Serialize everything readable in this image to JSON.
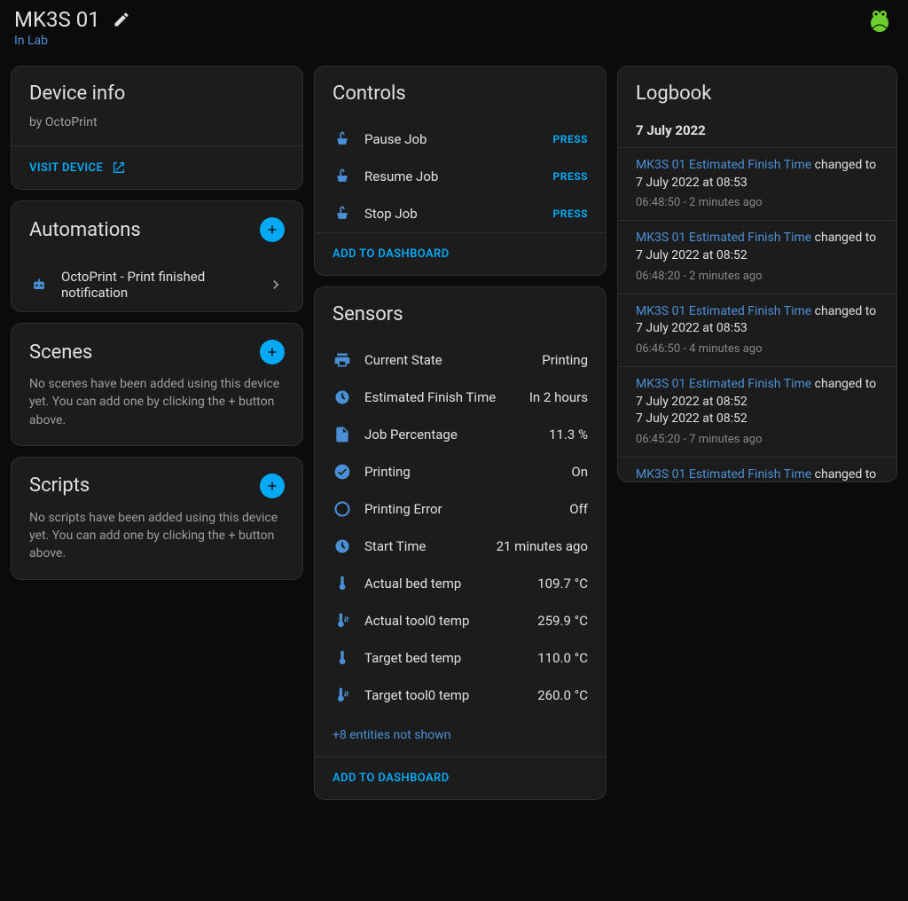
{
  "header": {
    "title": "MK3S 01",
    "subtitle": "In Lab"
  },
  "deviceInfo": {
    "title": "Device info",
    "subtitle": "by OctoPrint",
    "visit": "VISIT DEVICE"
  },
  "automations": {
    "title": "Automations",
    "items": [
      {
        "label": "OctoPrint - Print finished notification"
      }
    ]
  },
  "scenes": {
    "title": "Scenes",
    "body": "No scenes have been added using this device yet. You can add one by clicking the + button above."
  },
  "scripts": {
    "title": "Scripts",
    "body": "No scripts have been added using this device yet. You can add one by clicking the + button above."
  },
  "controls": {
    "title": "Controls",
    "press": "PRESS",
    "addToDashboard": "ADD TO DASHBOARD",
    "items": [
      {
        "label": "Pause Job"
      },
      {
        "label": "Resume Job"
      },
      {
        "label": "Stop Job"
      }
    ]
  },
  "sensors": {
    "title": "Sensors",
    "moreEntities": "+8 entities not shown",
    "addToDashboard": "ADD TO DASHBOARD",
    "items": [
      {
        "icon": "printer",
        "label": "Current State",
        "value": "Printing"
      },
      {
        "icon": "clock",
        "label": "Estimated Finish Time",
        "value": "In 2 hours"
      },
      {
        "icon": "file",
        "label": "Job Percentage",
        "value": "11.3 %"
      },
      {
        "icon": "check",
        "label": "Printing",
        "value": "On"
      },
      {
        "icon": "circle",
        "label": "Printing Error",
        "value": "Off"
      },
      {
        "icon": "clock",
        "label": "Start Time",
        "value": "21 minutes ago"
      },
      {
        "icon": "thermo",
        "label": "Actual bed temp",
        "value": "109.7 °C"
      },
      {
        "icon": "thermo-hot",
        "label": "Actual tool0 temp",
        "value": "259.9 °C"
      },
      {
        "icon": "thermo",
        "label": "Target bed temp",
        "value": "110.0 °C"
      },
      {
        "icon": "thermo-hot",
        "label": "Target tool0 temp",
        "value": "260.0 °C"
      }
    ]
  },
  "logbook": {
    "title": "Logbook",
    "date": "7 July 2022",
    "changedTo": "changed to",
    "entries": [
      {
        "entity": "MK3S 01 Estimated Finish Time",
        "value": "7 July 2022 at 08:53",
        "when": "06:48:50 - 2 minutes ago"
      },
      {
        "entity": "MK3S 01 Estimated Finish Time",
        "value": "7 July 2022 at 08:52",
        "when": "06:48:20 - 2 minutes ago"
      },
      {
        "entity": "MK3S 01 Estimated Finish Time",
        "value": "7 July 2022 at 08:53",
        "when": "06:46:50 - 4 minutes ago"
      },
      {
        "entity": "MK3S 01 Estimated Finish Time",
        "value": "7 July 2022 at 08:52\n7 July 2022 at 08:52",
        "when": "06:45:20 - 7 minutes ago"
      },
      {
        "entity": "MK3S 01 Estimated Finish Time",
        "value": "",
        "when": "",
        "partial": true
      }
    ]
  }
}
